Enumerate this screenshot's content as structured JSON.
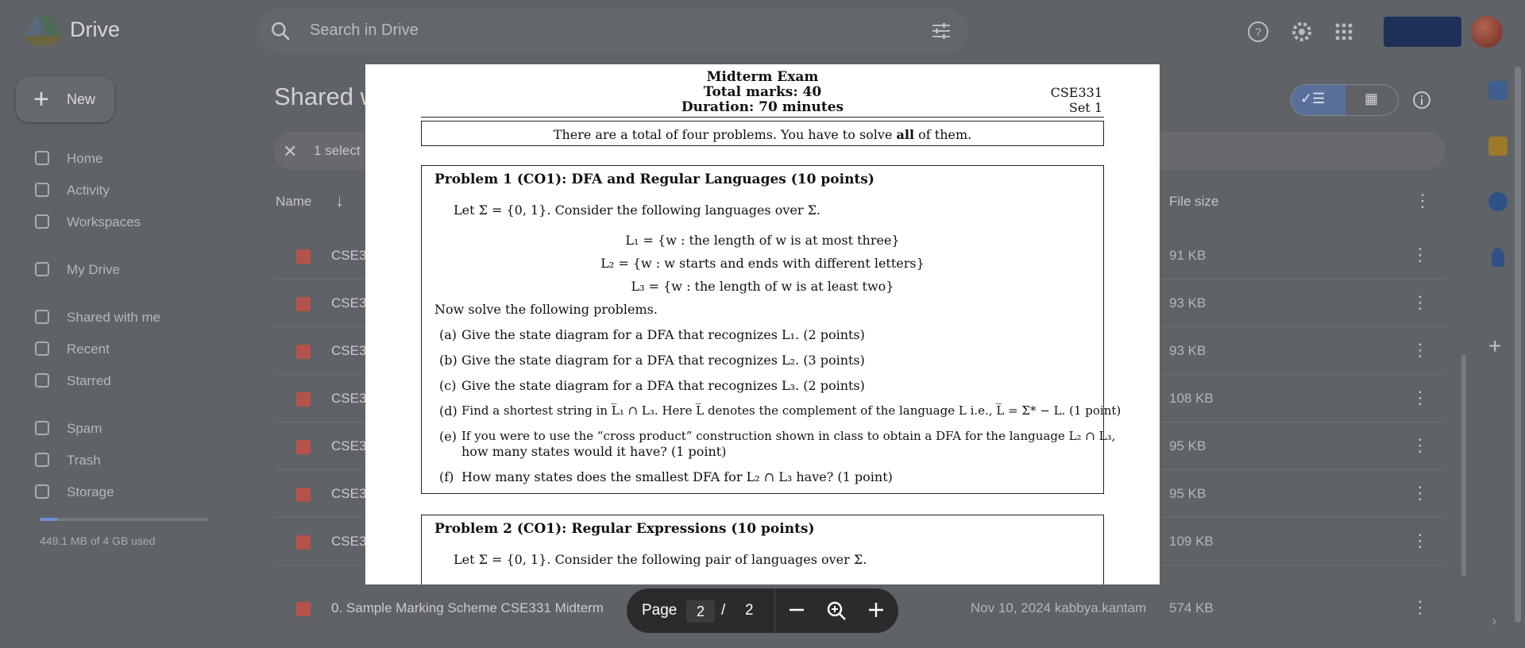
{
  "app": {
    "name": "Drive",
    "search_placeholder": "Search in Drive",
    "new_label": "New"
  },
  "sidebar": {
    "items": [
      {
        "label": "Home",
        "icon": "home-icon"
      },
      {
        "label": "Activity",
        "icon": "bell-icon"
      },
      {
        "label": "Workspaces",
        "icon": "workspaces-icon"
      },
      {
        "label": "My Drive",
        "icon": "drive-icon"
      },
      {
        "label": "Shared with me",
        "icon": "people-icon"
      },
      {
        "label": "Recent",
        "icon": "clock-icon"
      },
      {
        "label": "Starred",
        "icon": "star-icon"
      },
      {
        "label": "Spam",
        "icon": "spam-icon"
      },
      {
        "label": "Trash",
        "icon": "trash-icon"
      },
      {
        "label": "Storage",
        "icon": "cloud-icon"
      }
    ],
    "storage_text": "449.1 MB of 4 GB used",
    "storage_used_fraction": 0.11
  },
  "main": {
    "title": "Shared w",
    "selection_text": "1 select",
    "columns": {
      "name": "Name",
      "file_size": "File size"
    },
    "rows": [
      {
        "name": "CSE3",
        "date": "",
        "size": "91 KB"
      },
      {
        "name": "CSE3",
        "date": "",
        "size": "93 KB"
      },
      {
        "name": "CSE3",
        "date": "",
        "size": "93 KB"
      },
      {
        "name": "CSE3",
        "date": "",
        "size": "108 KB"
      },
      {
        "name": "CSE3",
        "date": "",
        "size": "95 KB"
      },
      {
        "name": "CSE3",
        "date": "",
        "size": "95 KB"
      },
      {
        "name": "CSE3",
        "date": "",
        "size": "109 KB"
      },
      {
        "name": "0. Sample Marking Scheme CSE331 Midterm",
        "date": "Nov 10, 2024 kabbya.kantam",
        "size": "574 KB"
      }
    ]
  },
  "document": {
    "title": "Midterm Exam",
    "total_marks": "Total marks: 40",
    "duration": "Duration: 70 minutes",
    "course": "CSE331",
    "set": "Set 1",
    "intro_before": "There are a total of four problems. You have to solve ",
    "intro_bold": "all",
    "intro_after": " of them.",
    "problem1": {
      "title": "Problem 1 (CO1): DFA and Regular Languages (10 points)",
      "preamble": "Let Σ = {0, 1}. Consider the following languages over Σ.",
      "l1": "L₁ = {w : the length of w is at most three}",
      "l2": "L₂ = {w : w starts and ends with different letters}",
      "l3": "L₃ = {w : the length of w is at least two}",
      "instruction": "Now solve the following problems.",
      "parts": [
        {
          "label": "(a)",
          "text": "Give the state diagram for a DFA that recognizes L₁. (2 points)"
        },
        {
          "label": "(b)",
          "text": "Give the state diagram for a DFA that recognizes L₂. (3 points)"
        },
        {
          "label": "(c)",
          "text": "Give the state diagram for a DFA that recognizes L₃. (2 points)"
        },
        {
          "label": "(d)",
          "text": "Find a shortest string in L̅₁ ∩ L₃. Here L̅ denotes the complement of the language L i.e., L̅ = Σ* − L. (1 point)"
        },
        {
          "label": "(e)",
          "text": "If you were to use the “cross product” construction shown in class to obtain a DFA for the language L₂ ∩ L₃,",
          "text2": "how many states would it have? (1 point)"
        },
        {
          "label": "(f)",
          "text": "How many states does the smallest DFA for L₂ ∩ L₃ have? (1 point)"
        }
      ]
    },
    "problem2": {
      "title": "Problem 2 (CO1): Regular Expressions (10 points)",
      "preamble": "Let Σ = {0, 1}. Consider the following pair of languages over Σ."
    }
  },
  "pager": {
    "label": "Page",
    "current": "2",
    "separator": "/",
    "total": "2"
  }
}
